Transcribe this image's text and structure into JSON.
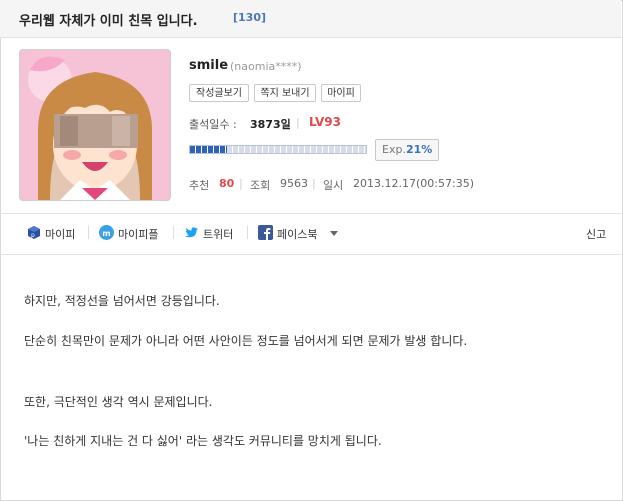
{
  "post": {
    "title": "우리웹 자체가 이미 친목 입니다.",
    "comment_count": "[130]"
  },
  "author": {
    "nickname": "smile",
    "user_id": "(naomia****)",
    "buttons": [
      "작성글보기",
      "쪽지 보내기",
      "마이피"
    ],
    "attend_label": "출석일수 :",
    "attend_value": "3873일",
    "level": "LV93",
    "exp_label": "Exp.",
    "exp_percent": "21%",
    "exp_fraction": 0.21
  },
  "meta": {
    "recommend_label": "추천",
    "recommend_value": "80",
    "views_label": "조회",
    "views_value": "9563",
    "date_label": "일시",
    "date_value": "2013.12.17",
    "time_value": "(00:57:35)"
  },
  "share": {
    "mypi": "마이피",
    "mypeople": "마이피플",
    "twitter": "트위터",
    "facebook": "페이스북",
    "report": "신고"
  },
  "content": {
    "p1": "하지만, 적정선을 넘어서면 강등입니다.",
    "p2": "단순히 친목만이 문제가 아니라 어떤 사안이든 정도를 넘어서게 되면 문제가 발생 합니다.",
    "p3": "또한, 극단적인 생각 역시 문제입니다.",
    "p4": "'나는 친하게 지내는 건 다 싫어' 라는 생각도 커뮤니티를 망치게 됩니다."
  },
  "colors": {
    "accent_blue": "#3c6fc1",
    "accent_red": "#e04b4b",
    "twitter_blue": "#1da1f2",
    "facebook_blue": "#3b5998"
  }
}
